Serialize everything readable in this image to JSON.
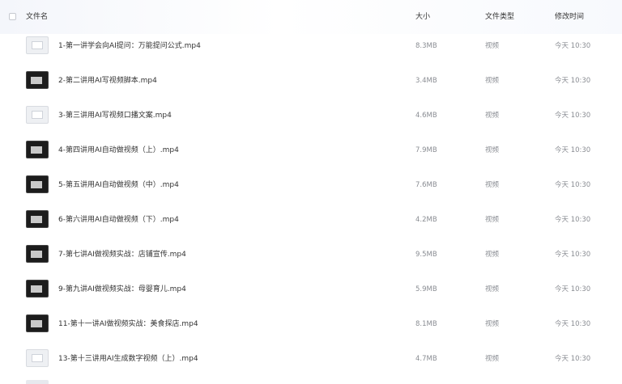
{
  "header": {
    "name_label": "文件名",
    "size_label": "大小",
    "type_label": "文件类型",
    "time_label": "修改时间"
  },
  "files": [
    {
      "name": "1-第一讲学会向AI提问：万能提问公式.mp4",
      "size": "8.3MB",
      "type": "视频",
      "time": "今天 10:30",
      "thumb": "light"
    },
    {
      "name": "2-第二讲用AI写视频脚本.mp4",
      "size": "3.4MB",
      "type": "视频",
      "time": "今天 10:30",
      "thumb": "dark"
    },
    {
      "name": "3-第三讲用AI写视频口播文案.mp4",
      "size": "4.6MB",
      "type": "视频",
      "time": "今天 10:30",
      "thumb": "light"
    },
    {
      "name": "4-第四讲用AI自动做视频（上）.mp4",
      "size": "7.9MB",
      "type": "视频",
      "time": "今天 10:30",
      "thumb": "dark"
    },
    {
      "name": "5-第五讲用AI自动做视频（中）.mp4",
      "size": "7.6MB",
      "type": "视频",
      "time": "今天 10:30",
      "thumb": "dark"
    },
    {
      "name": "6-第六讲用AI自动做视频（下）.mp4",
      "size": "4.2MB",
      "type": "视频",
      "time": "今天 10:30",
      "thumb": "dark"
    },
    {
      "name": "7-第七讲AI做视频实战：店铺宣传.mp4",
      "size": "9.5MB",
      "type": "视频",
      "time": "今天 10:30",
      "thumb": "dark"
    },
    {
      "name": "9-第九讲AI做视频实战：母婴育儿.mp4",
      "size": "5.9MB",
      "type": "视频",
      "time": "今天 10:30",
      "thumb": "dark"
    },
    {
      "name": "11-第十一讲AI做视频实战：美食探店.mp4",
      "size": "8.1MB",
      "type": "视频",
      "time": "今天 10:30",
      "thumb": "dark"
    },
    {
      "name": "13-第十三讲用AI生成数字视频（上）.mp4",
      "size": "4.7MB",
      "type": "视频",
      "time": "今天 10:30",
      "thumb": "light"
    }
  ]
}
